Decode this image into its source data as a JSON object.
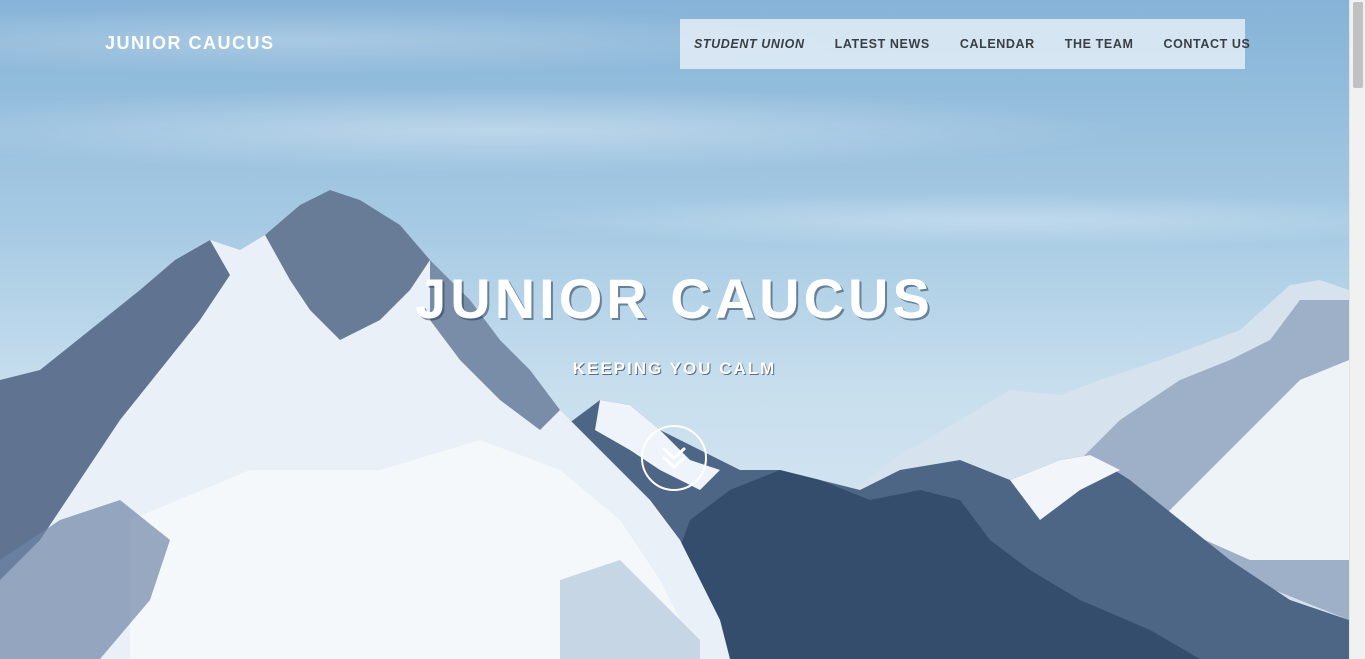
{
  "brand": {
    "name": "JUNIOR CAUCUS"
  },
  "nav": {
    "items": [
      {
        "label": "STUDENT UNION",
        "active": true
      },
      {
        "label": "LATEST NEWS",
        "active": false
      },
      {
        "label": "CALENDAR",
        "active": false
      },
      {
        "label": "THE TEAM",
        "active": false
      },
      {
        "label": "CONTACT US",
        "active": false
      }
    ]
  },
  "hero": {
    "title": "JUNIOR CAUCUS",
    "subtitle": "KEEPING YOU CALM",
    "scroll_icon": "double-chevron-down-icon",
    "background": "snowy-mountains-photo"
  },
  "colors": {
    "sky": "#a7cbe4",
    "nav_background": "#ebf2f8",
    "nav_text": "#3a3f45",
    "text_light": "#ffffff"
  }
}
